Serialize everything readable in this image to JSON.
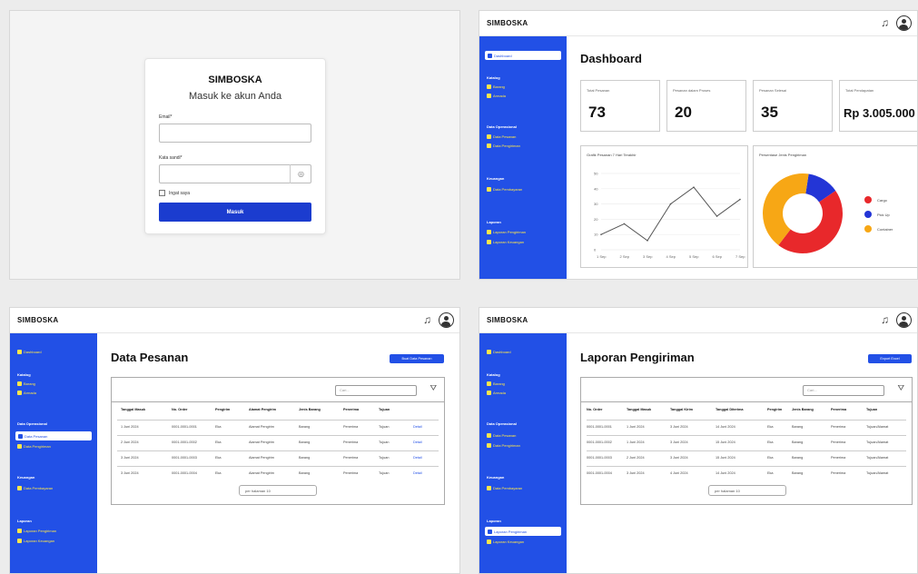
{
  "login": {
    "brand": "SIMBOSKA",
    "subtitle": "Masuk ke akun Anda",
    "email_label": "Email*",
    "password_label": "Kata sandi*",
    "remember_label": "Ingat saya",
    "submit_label": "Masuk"
  },
  "app": {
    "brand": "SIMBOSKA",
    "accent": "#2250e6",
    "sidebar_item_color": "#fde64b",
    "sidebar": {
      "dashboard": "Dashboard",
      "master_head": "Katalog",
      "master_items": [
        "Barang",
        "Armada"
      ],
      "ops_head": "Data Operasional",
      "ops_items": [
        "Data Pesanan",
        "Data Pengiriman"
      ],
      "finance_head": "Keuangan",
      "finance_items": [
        "Data Pembayaran"
      ],
      "report_head": "Laporan",
      "report_items": [
        "Laporan Pengiriman",
        "Laporan Keuangan"
      ]
    }
  },
  "dashboard": {
    "title": "Dashboard",
    "stats": [
      {
        "label": "Total Pesanan",
        "value": "73"
      },
      {
        "label": "Pesanan dalam Proses",
        "value": "20"
      },
      {
        "label": "Pesanan Selesai",
        "value": "35"
      },
      {
        "label": "Total Pendapatan",
        "value": "Rp 3.005.000"
      }
    ],
    "line_chart_title": "Grafik Pesanan 7 Hari Terakhir",
    "pie_chart_title": "Persentase Jenis Pengiriman"
  },
  "chart_data": [
    {
      "type": "line",
      "title": "Grafik Pesanan 7 Hari Terakhir",
      "x": [
        "1 Sep",
        "2 Sep",
        "3 Sep",
        "4 Sep",
        "5 Sep",
        "6 Sep",
        "7 Sep"
      ],
      "values": [
        10,
        17,
        6,
        30,
        41,
        22,
        33
      ],
      "ylim": [
        0,
        50
      ],
      "ytick_labels": [
        "0",
        "10",
        "20",
        "30",
        "40",
        "50"
      ],
      "grid": true
    },
    {
      "type": "pie",
      "title": "Persentase Jenis Pengiriman",
      "labels": [
        "Cargo",
        "Pick Up",
        "Container"
      ],
      "values": [
        45,
        13,
        42
      ],
      "colors": [
        "#e8282b",
        "#2335d6",
        "#f7a715"
      ],
      "legend": "right"
    }
  ],
  "orders": {
    "title": "Data Pesanan",
    "add_button": "Buat Data Pesanan",
    "search_placeholder": "Cari...",
    "columns": [
      "Tanggal Masuk",
      "No. Order",
      "Pengirim",
      "Alamat Pengirim",
      "Jenis Barang",
      "Penerima",
      "Tujuan",
      ""
    ],
    "rows": [
      [
        "1 Juni 2024",
        "0001-0001-0001",
        "Eka",
        "Alamat Pengirim",
        "Barang",
        "Penerima",
        "Tujuan",
        "Detail"
      ],
      [
        "2 Juni 2024",
        "0001-0001-0002",
        "Eka",
        "Alamat Pengirim",
        "Barang",
        "Penerima",
        "Tujuan",
        "Detail"
      ],
      [
        "3 Juni 2024",
        "0001-0001-0003",
        "Eka",
        "Alamat Pengirim",
        "Barang",
        "Penerima",
        "Tujuan",
        "Detail"
      ],
      [
        "3 Juni 2024",
        "0001-0001-0004",
        "Eka",
        "Alamat Pengirim",
        "Barang",
        "Penerima",
        "Tujuan",
        "Detail"
      ]
    ],
    "pager": "per halaman  10"
  },
  "report": {
    "title": "Laporan Pengiriman",
    "export_button": "Export Excel",
    "search_placeholder": "Cari...",
    "columns": [
      "No. Order",
      "Tanggal Masuk",
      "Tanggal Kirim",
      "Tanggal Diterima",
      "Pengirim",
      "Jenis Barang",
      "Penerima",
      "Tujuan"
    ],
    "rows": [
      [
        "0001-0001-0001",
        "1 Juni 2024",
        "3 Juni 2024",
        "14 Juni 2024",
        "Eka",
        "Barang",
        "Penerima",
        "Tujuan/Alamat"
      ],
      [
        "0001-0001-0002",
        "1 Juni 2024",
        "3 Juni 2024",
        "15 Juni 2024",
        "Eka",
        "Barang",
        "Penerima",
        "Tujuan/Alamat"
      ],
      [
        "0001-0001-0003",
        "2 Juni 2024",
        "3 Juni 2024",
        "15 Juni 2024",
        "Eka",
        "Barang",
        "Penerima",
        "Tujuan/Alamat"
      ],
      [
        "0001-0001-0004",
        "3 Juni 2024",
        "4 Juni 2024",
        "14 Juni 2024",
        "Eka",
        "Barang",
        "Penerima",
        "Tujuan/Alamat"
      ]
    ],
    "pager": "per halaman  10"
  }
}
